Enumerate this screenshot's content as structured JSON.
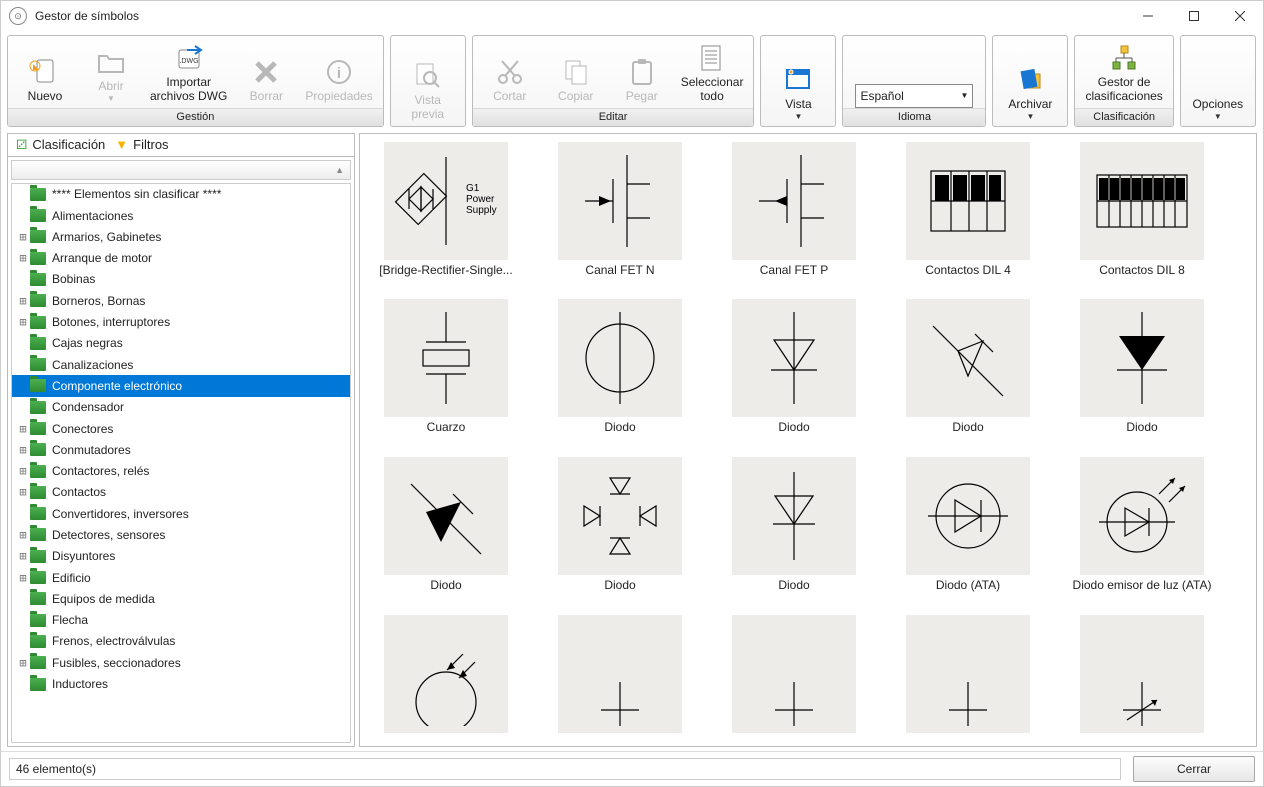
{
  "window": {
    "title": "Gestor de símbolos"
  },
  "ribbon": {
    "groups": [
      {
        "label": "Gestión",
        "buttons": [
          {
            "key": "nuevo",
            "label": "Nuevo",
            "icon": "new-file",
            "disabled": false,
            "drop": false
          },
          {
            "key": "abrir",
            "label": "Abrir",
            "icon": "open-folder",
            "disabled": true,
            "drop": true
          },
          {
            "key": "importar",
            "label": "Importar\narchivos DWG",
            "icon": "import-dwg",
            "disabled": false,
            "drop": false
          },
          {
            "key": "borrar",
            "label": "Borrar",
            "icon": "delete-x",
            "disabled": true,
            "drop": false
          },
          {
            "key": "props",
            "label": "Propiedades",
            "icon": "info",
            "disabled": true,
            "drop": false
          }
        ]
      },
      {
        "label": "",
        "buttons": [
          {
            "key": "preview",
            "label": "Vista\nprevia",
            "icon": "magnify",
            "disabled": true,
            "drop": false
          }
        ]
      },
      {
        "label": "Editar",
        "buttons": [
          {
            "key": "cortar",
            "label": "Cortar",
            "icon": "scissors",
            "disabled": true,
            "drop": false
          },
          {
            "key": "copiar",
            "label": "Copiar",
            "icon": "copy",
            "disabled": true,
            "drop": false
          },
          {
            "key": "pegar",
            "label": "Pegar",
            "icon": "paste",
            "disabled": true,
            "drop": false
          },
          {
            "key": "selall",
            "label": "Seleccionar\ntodo",
            "icon": "select-all",
            "disabled": false,
            "drop": false
          }
        ]
      },
      {
        "label": "",
        "buttons": [
          {
            "key": "vista",
            "label": "Vista",
            "icon": "view",
            "disabled": false,
            "drop": true
          }
        ]
      },
      {
        "label": "Idioma",
        "buttons": [],
        "combo": {
          "value": "Español"
        }
      },
      {
        "label": "",
        "buttons": [
          {
            "key": "archivar",
            "label": "Archivar",
            "icon": "archive",
            "disabled": false,
            "drop": true
          }
        ]
      },
      {
        "label": "Clasificación",
        "buttons": [
          {
            "key": "gestor-clas",
            "label": "Gestor de\nclasificaciones",
            "icon": "classify",
            "disabled": false,
            "drop": false
          }
        ]
      },
      {
        "label": "",
        "buttons": [
          {
            "key": "opciones",
            "label": "Opciones",
            "icon": "",
            "disabled": false,
            "drop": true
          }
        ]
      }
    ]
  },
  "tabs": {
    "classification": "Clasificación",
    "filters": "Filtros"
  },
  "tree": [
    {
      "label": "**** Elementos sin clasificar ****",
      "exp": ""
    },
    {
      "label": "Alimentaciones",
      "exp": ""
    },
    {
      "label": "Armarios, Gabinetes",
      "exp": "+"
    },
    {
      "label": "Arranque de motor",
      "exp": "+"
    },
    {
      "label": "Bobinas",
      "exp": ""
    },
    {
      "label": "Borneros, Bornas",
      "exp": "+"
    },
    {
      "label": "Botones, interruptores",
      "exp": "+"
    },
    {
      "label": "Cajas negras",
      "exp": ""
    },
    {
      "label": "Canalizaciones",
      "exp": ""
    },
    {
      "label": "Componente electrónico",
      "exp": "",
      "selected": true
    },
    {
      "label": "Condensador",
      "exp": ""
    },
    {
      "label": "Conectores",
      "exp": "+"
    },
    {
      "label": "Conmutadores",
      "exp": "+"
    },
    {
      "label": "Contactores, relés",
      "exp": "+"
    },
    {
      "label": "Contactos",
      "exp": "+"
    },
    {
      "label": "Convertidores, inversores",
      "exp": ""
    },
    {
      "label": "Detectores, sensores",
      "exp": "+"
    },
    {
      "label": "Disyuntores",
      "exp": "+"
    },
    {
      "label": "Edificio",
      "exp": "+"
    },
    {
      "label": "Equipos de medida",
      "exp": ""
    },
    {
      "label": "Flecha",
      "exp": ""
    },
    {
      "label": "Frenos, electroválvulas",
      "exp": ""
    },
    {
      "label": "Fusibles, seccionadores",
      "exp": "+"
    },
    {
      "label": "Inductores",
      "exp": ""
    }
  ],
  "symbols": [
    {
      "label": "[Bridge-Rectifier-Single...",
      "icon": "bridge"
    },
    {
      "label": "Canal FET N",
      "icon": "fet-n"
    },
    {
      "label": "Canal FET P",
      "icon": "fet-p"
    },
    {
      "label": "Contactos DIL 4",
      "icon": "dil4"
    },
    {
      "label": "Contactos DIL 8",
      "icon": "dil8"
    },
    {
      "label": "Cuarzo",
      "icon": "cuarzo"
    },
    {
      "label": "Diodo",
      "icon": "diodo-circle"
    },
    {
      "label": "Diodo",
      "icon": "diodo-open"
    },
    {
      "label": "Diodo",
      "icon": "diodo-cross"
    },
    {
      "label": "Diodo",
      "icon": "diodo-filled"
    },
    {
      "label": "Diodo",
      "icon": "diodo-black"
    },
    {
      "label": "Diodo",
      "icon": "diodo-multi"
    },
    {
      "label": "Diodo",
      "icon": "diodo-v"
    },
    {
      "label": "Diodo (ATA)",
      "icon": "diodo-ata"
    },
    {
      "label": "Diodo emisor de luz (ATA)",
      "icon": "led-ata"
    },
    {
      "label": "",
      "icon": "partial1"
    },
    {
      "label": "",
      "icon": "partial2"
    },
    {
      "label": "",
      "icon": "partial3"
    },
    {
      "label": "",
      "icon": "partial4"
    },
    {
      "label": "",
      "icon": "partial5"
    }
  ],
  "bridge_text": {
    "l1": "G1",
    "l2": "Power",
    "l3": "Supply"
  },
  "footer": {
    "status": "46 elemento(s)",
    "close": "Cerrar"
  }
}
